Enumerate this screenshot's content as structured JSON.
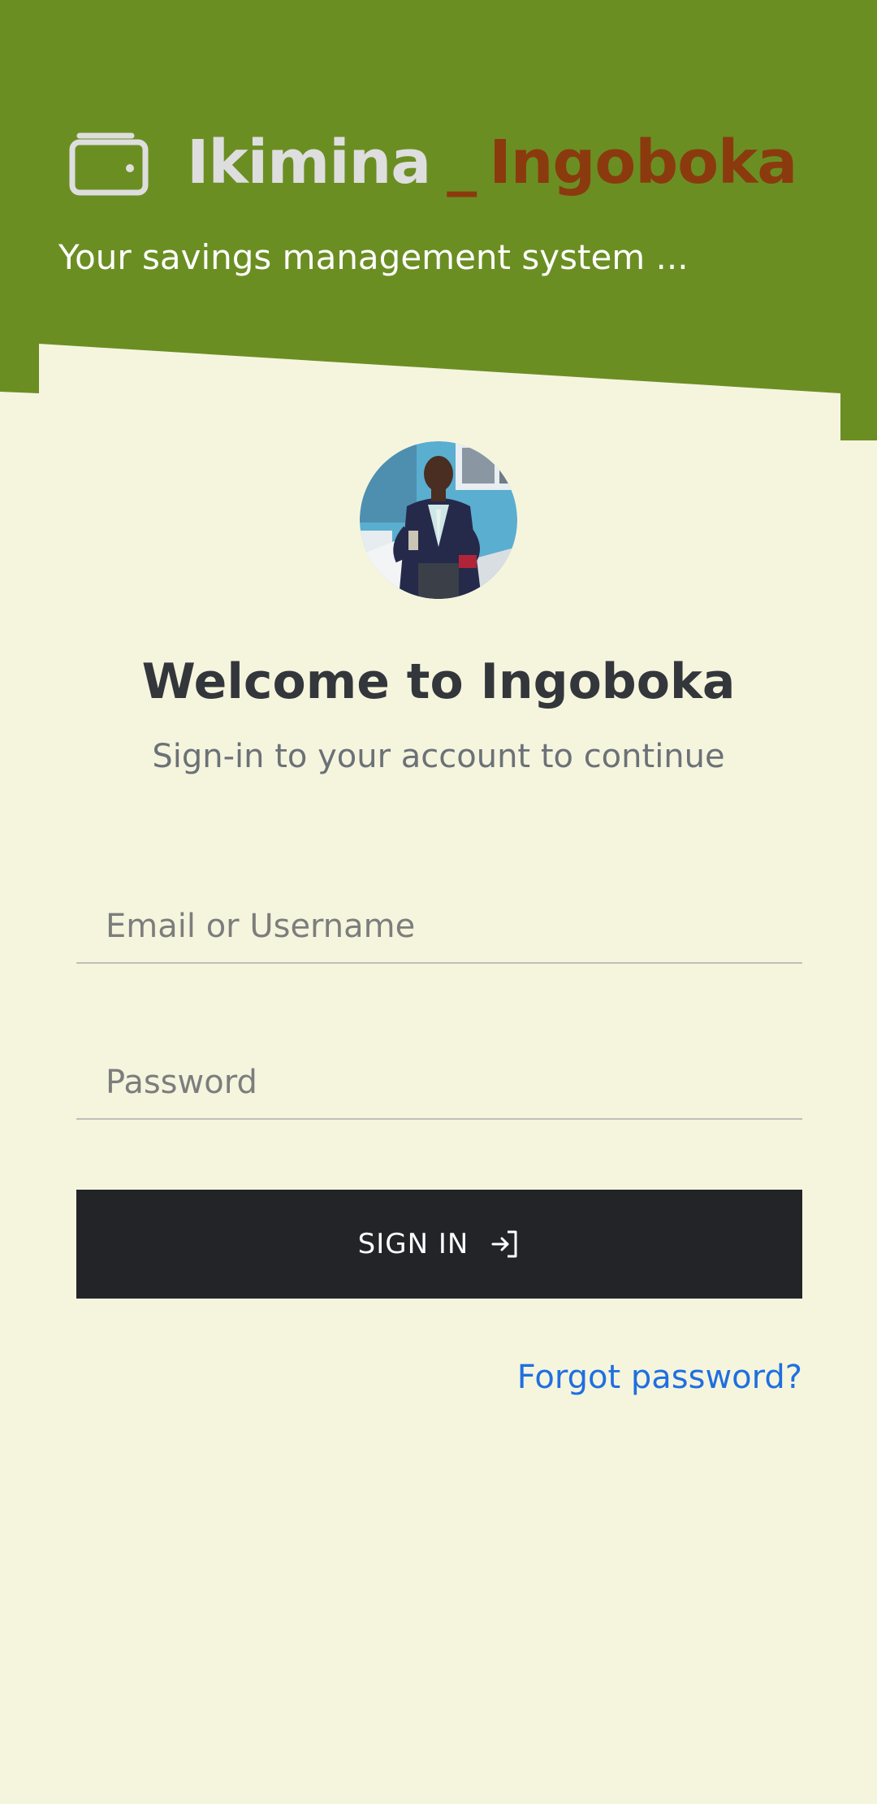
{
  "header": {
    "brand_part1": "Ikimina",
    "brand_separator": "_",
    "brand_part2": "Ingoboka",
    "tagline": "Your savings management system ...",
    "background_color": "#6b8e23",
    "brand_accent_color": "#8b3a0e",
    "icon": "wallet-icon"
  },
  "login": {
    "title": "Welcome to Ingoboka",
    "subtitle": "Sign-in to your account to continue",
    "email_placeholder": "Email or Username",
    "email_value": "",
    "password_placeholder": "Password",
    "password_value": "",
    "signin_label": "SIGN IN",
    "signin_icon": "login-icon",
    "forgot_password_label": "Forgot password?",
    "button_color": "#222428",
    "link_color": "#1f6fe0"
  }
}
